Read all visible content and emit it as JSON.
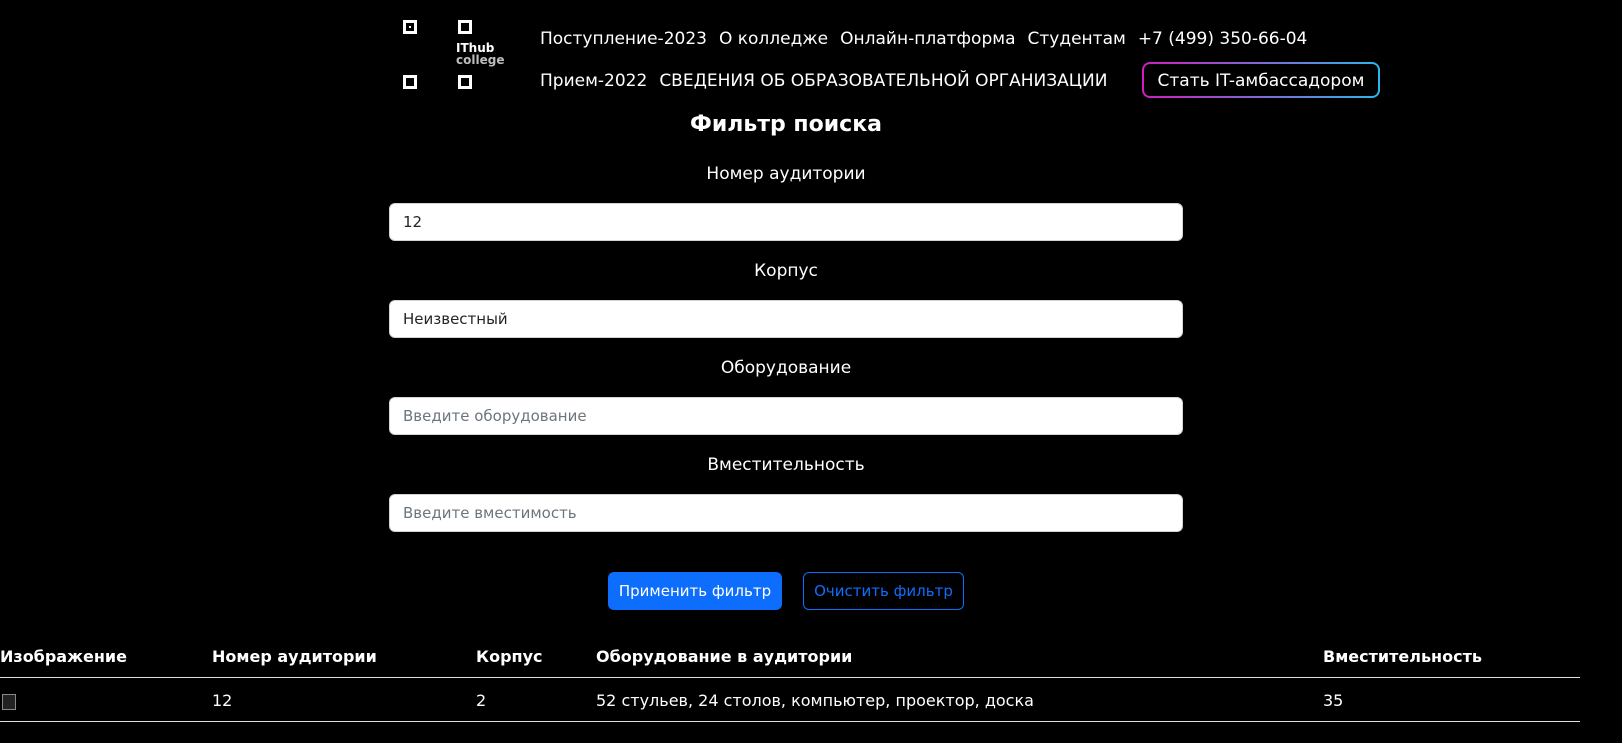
{
  "logo": {
    "line1": "IThub",
    "line2": "college"
  },
  "nav": {
    "row1": [
      "Поступление-2023",
      "О колледже",
      "Онлайн-платформа",
      "Студентам",
      "+7 (499) 350-66-04"
    ],
    "row2": [
      "Прием-2022",
      "СВЕДЕНИЯ ОБ ОБРАЗОВАТЕЛЬНОЙ ОРГАНИЗАЦИИ"
    ],
    "ambassador_button": "Стать IT-амбассадором"
  },
  "filter": {
    "title": "Фильтр поиска",
    "room_label": "Номер аудитории",
    "room_value": "12",
    "building_label": "Корпус",
    "building_value": "Неизвестный",
    "equipment_label": "Оборудование",
    "equipment_placeholder": "Введите оборудование",
    "capacity_label": "Вместительность",
    "capacity_placeholder": "Введите вместимость",
    "apply_button": "Применить фильтр",
    "clear_button": "Очистить фильтр"
  },
  "table": {
    "headers": [
      "Изображение",
      "Номер аудитории",
      "Корпус",
      "Оборудование в аудитории",
      "Вместительность"
    ],
    "rows": [
      {
        "room": "12",
        "building": "2",
        "equipment": "52 стульев, 24 столов, компьютер, проектор, доска",
        "capacity": "35"
      }
    ]
  }
}
